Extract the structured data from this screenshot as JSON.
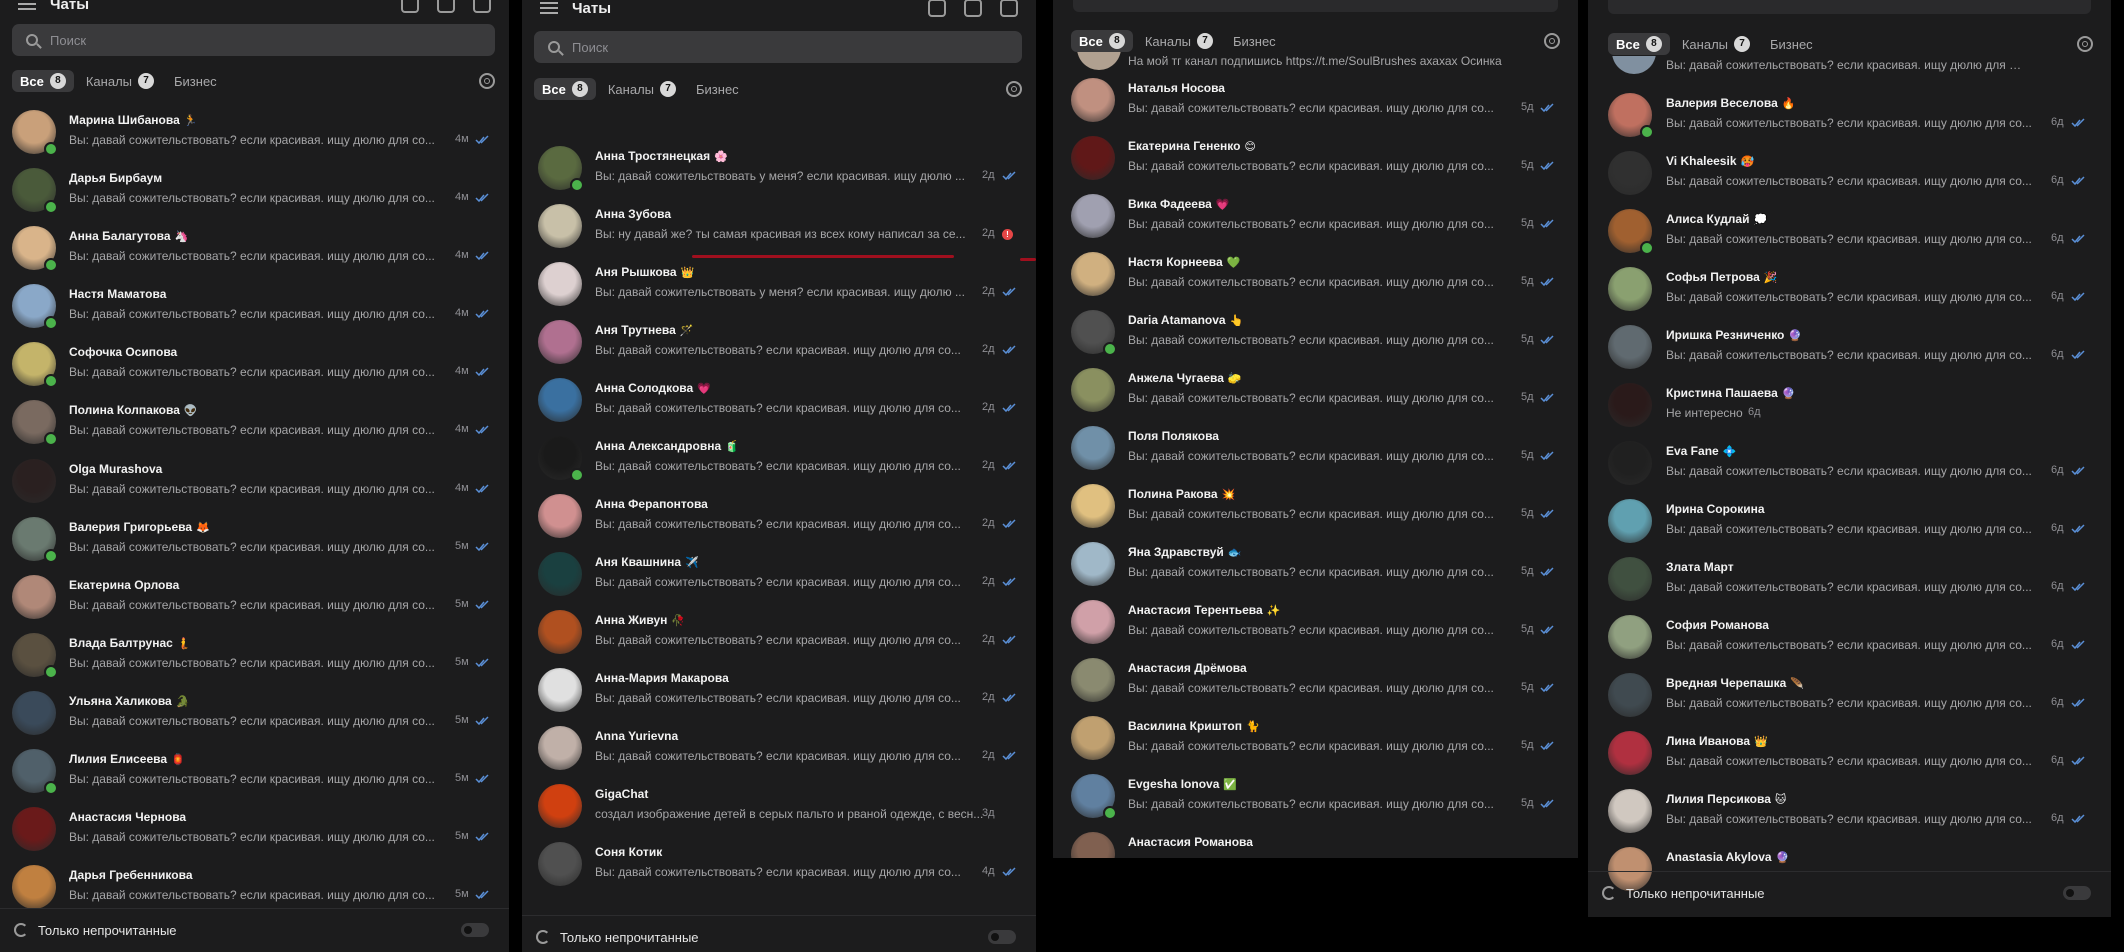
{
  "common": {
    "search_placeholder": "Поиск",
    "filter_all": "Все",
    "filter_all_count": "8",
    "filter_channels": "Каналы",
    "filter_channels_count": "7",
    "filter_business": "Бизнес",
    "footer_label": "Только непрочитанные",
    "title": "Чаты"
  },
  "colors": {
    "online": "#4bb34b",
    "checks": "#5a8fd6",
    "accent_red": "#a00f1e",
    "panel": "#1c1c1d"
  },
  "panels": [
    {
      "time_default": "4м",
      "chats": [
        {
          "name": "Марина Шибанова",
          "emoji": "🏃",
          "msg": "Вы: давай сожительствовать? если красивая. ищу дюлю для со...",
          "time": "4м",
          "online": true,
          "color": "#c9a07a"
        },
        {
          "name": "Дарья Бирбаум",
          "emoji": "",
          "msg": "Вы: давай сожительствовать? если красивая. ищу дюлю для со...",
          "time": "4м",
          "online": true,
          "color": "#4a5a3a"
        },
        {
          "name": "Анна Балагутова",
          "emoji": "🦄",
          "msg": "Вы: давай сожительствовать? если красивая. ищу дюлю для со...",
          "time": "4м",
          "online": true,
          "color": "#d9b48a"
        },
        {
          "name": "Настя Маматова",
          "emoji": "",
          "msg": "Вы: давай сожительствовать? если красивая. ищу дюлю для со...",
          "time": "4м",
          "online": true,
          "color": "#8aa8c8"
        },
        {
          "name": "Софочка Осипова",
          "emoji": "",
          "msg": "Вы: давай сожительствовать? если красивая. ищу дюлю для со...",
          "time": "4м",
          "online": true,
          "color": "#c4b46a"
        },
        {
          "name": "Полина Колпакова",
          "emoji": "👽",
          "msg": "Вы: давай сожительствовать? если красивая. ищу дюлю для со...",
          "time": "4м",
          "online": true,
          "color": "#7a6a60"
        },
        {
          "name": "Olga Murashova",
          "emoji": "",
          "msg": "Вы: давай сожительствовать? если красивая. ищу дюлю для со...",
          "time": "4м",
          "online": false,
          "color": "#2a2020"
        },
        {
          "name": "Валерия Григорьева",
          "emoji": "🦊",
          "msg": "Вы: давай сожительствовать? если красивая. ищу дюлю для со...",
          "time": "5м",
          "online": true,
          "color": "#6a7a70"
        },
        {
          "name": "Екатерина Орлова",
          "emoji": "",
          "msg": "Вы: давай сожительствовать? если красивая. ищу дюлю для со...",
          "time": "5м",
          "online": false,
          "color": "#b08878"
        },
        {
          "name": "Влада Балтрунас",
          "emoji": "🧜",
          "msg": "Вы: давай сожительствовать? если красивая. ищу дюлю для со...",
          "time": "5м",
          "online": true,
          "color": "#5a5040"
        },
        {
          "name": "Ульяна Халикова",
          "emoji": "🐊",
          "msg": "Вы: давай сожительствовать? если красивая. ищу дюлю для со...",
          "time": "5м",
          "online": false,
          "color": "#3a4a5a"
        },
        {
          "name": "Лилия Елисеева",
          "emoji": "🏮",
          "msg": "Вы: давай сожительствовать? если красивая. ищу дюлю для со...",
          "time": "5м",
          "online": true,
          "color": "#50606a"
        },
        {
          "name": "Анастасия Чернова",
          "emoji": "",
          "msg": "Вы: давай сожительствовать? если красивая. ищу дюлю для со...",
          "time": "5м",
          "online": false,
          "color": "#6a1a1a"
        },
        {
          "name": "Дарья Гребенникова",
          "emoji": "",
          "msg": "Вы: давай сожительствовать? если красивая. ищу дюлю для со...",
          "time": "5м",
          "online": false,
          "color": "#c08040"
        }
      ]
    },
    {
      "chats": [
        {
          "name": "Анна Тростянецкая",
          "emoji": "🌸",
          "msg": "Вы: давай сожительствовать у меня? если красивая. ищу дюлю ...",
          "time": "2д",
          "online": true,
          "color": "#5a6a40"
        },
        {
          "name": "Анна Зубова",
          "emoji": "",
          "msg": "Вы: ну давай же? ты самая красивая из всех кому написал за се...",
          "time": "2д",
          "online": false,
          "color": "#c8c0a8",
          "unread": true
        },
        {
          "name": "Аня Рышкова",
          "emoji": "👑",
          "msg": "Вы: давай сожительствовать у меня? если красивая. ищу дюлю ...",
          "time": "2д",
          "online": false,
          "color": "#ddd0d0"
        },
        {
          "name": "Аня Трутнева",
          "emoji": "🪄",
          "msg": "Вы: давай сожительствовать? если красивая. ищу дюлю для со...",
          "time": "2д",
          "online": false,
          "color": "#b07090"
        },
        {
          "name": "Анна Солодкова",
          "emoji": "💗",
          "msg": "Вы: давай сожительствовать? если красивая. ищу дюлю для со...",
          "time": "2д",
          "online": false,
          "color": "#3a70a0"
        },
        {
          "name": "Анна Александровна",
          "emoji": "🧃",
          "msg": "Вы: давай сожительствовать? если красивая. ищу дюлю для со...",
          "time": "2д",
          "online": true,
          "color": "#1a1a1a"
        },
        {
          "name": "Анна Ферапонтова",
          "emoji": "",
          "msg": "Вы: давай сожительствовать? если красивая. ищу дюлю для со...",
          "time": "2д",
          "online": false,
          "color": "#d09090"
        },
        {
          "name": "Аня Квашнина",
          "emoji": "✈️",
          "msg": "Вы: давай сожительствовать? если красивая. ищу дюлю для со...",
          "time": "2д",
          "online": false,
          "color": "#1a4040"
        },
        {
          "name": "Анна Живун",
          "emoji": "🥀",
          "msg": "Вы: давай сожительствовать? если красивая. ищу дюлю для со...",
          "time": "2д",
          "online": false,
          "color": "#b05020"
        },
        {
          "name": "Анна-Мария Макарова",
          "emoji": "",
          "msg": "Вы: давай сожительствовать? если красивая. ищу дюлю для со...",
          "time": "2д",
          "online": false,
          "color": "#e0e0e0"
        },
        {
          "name": "Anna Yurievna",
          "emoji": "",
          "msg": "Вы: давай сожительствовать? если красивая. ищу дюлю для со...",
          "time": "2д",
          "online": false,
          "color": "#c0b0a8"
        },
        {
          "name": "GigaChat",
          "emoji": "",
          "msg": "создал изображение детей в серых пальто и рваной одежде, с весн...",
          "time": "3д",
          "online": false,
          "color": "#d04010",
          "nocheck": true
        },
        {
          "name": "Соня Котик",
          "emoji": "",
          "msg": "Вы: давай сожительствовать? если красивая. ищу дюлю для со...",
          "time": "4д",
          "online": false,
          "color": "#505050"
        }
      ]
    },
    {
      "top_fragment": "На мой тг канал подпишись https://t.me/SoulBrushes ахахах Осинка",
      "chats": [
        {
          "name": "Наталья Носова",
          "emoji": "",
          "msg": "Вы: давай сожительствовать? если красивая. ищу дюлю для со...",
          "time": "5д",
          "online": false,
          "color": "#c09080"
        },
        {
          "name": "Екатерина Гененко",
          "emoji": "😊",
          "msg": "Вы: давай сожительствовать? если красивая. ищу дюлю для со...",
          "time": "5д",
          "online": false,
          "color": "#601818"
        },
        {
          "name": "Вика Фадеева",
          "emoji": "💗",
          "msg": "Вы: давай сожительствовать? если красивая. ищу дюлю для со...",
          "time": "5д",
          "online": false,
          "color": "#a0a0b0"
        },
        {
          "name": "Настя Корнеева",
          "emoji": "💚",
          "msg": "Вы: давай сожительствовать? если красивая. ищу дюлю для со...",
          "time": "5д",
          "online": false,
          "color": "#d0b080"
        },
        {
          "name": "Daria Atamanova",
          "emoji": "👆",
          "msg": "Вы: давай сожительствовать? если красивая. ищу дюлю для со...",
          "time": "5д",
          "online": true,
          "color": "#505050"
        },
        {
          "name": "Анжела Чугаева",
          "emoji": "🧽",
          "msg": "Вы: давай сожительствовать? если красивая. ищу дюлю для со...",
          "time": "5д",
          "online": false,
          "color": "#8a9060"
        },
        {
          "name": "Поля Полякова",
          "emoji": "",
          "msg": "Вы: давай сожительствовать? если красивая. ищу дюлю для со...",
          "time": "5д",
          "online": false,
          "color": "#7090a8"
        },
        {
          "name": "Полина Ракова",
          "emoji": "💥",
          "msg": "Вы: давай сожительствовать? если красивая. ищу дюлю для со...",
          "time": "5д",
          "online": false,
          "color": "#e0c080"
        },
        {
          "name": "Яна Здравствуй",
          "emoji": "🐟",
          "msg": "Вы: давай сожительствовать? если красивая. ищу дюлю для со...",
          "time": "5д",
          "online": false,
          "color": "#a0b8c8"
        },
        {
          "name": "Анастасия Терентьева",
          "emoji": "✨",
          "msg": "Вы: давай сожительствовать? если красивая. ищу дюлю для со...",
          "time": "5д",
          "online": false,
          "color": "#d0a0a8"
        },
        {
          "name": "Анастасия Дрёмова",
          "emoji": "",
          "msg": "Вы: давай сожительствовать? если красивая. ищу дюлю для со...",
          "time": "5д",
          "online": false,
          "color": "#8a8a70"
        },
        {
          "name": "Василина Криштоп",
          "emoji": "🐈",
          "msg": "Вы: давай сожительствовать? если красивая. ищу дюлю для со...",
          "time": "5д",
          "online": false,
          "color": "#c0a070"
        },
        {
          "name": "Evgesha Ionova",
          "emoji": "✅",
          "msg": "Вы: давай сожительствовать? если красивая. ищу дюлю для со...",
          "time": "5д",
          "online": true,
          "color": "#6080a0"
        },
        {
          "name": "Анастасия Романова",
          "emoji": "",
          "msg": "",
          "time": "",
          "online": false,
          "color": "#806050"
        }
      ]
    },
    {
      "chats": [
        {
          "name": "Валерия Веселова",
          "emoji": "🔥",
          "msg": "Вы: давай сожительствовать? если красивая. ищу дюлю для со...",
          "time": "6д",
          "online": true,
          "color": "#c07060"
        },
        {
          "name": "Vi Khaleesik",
          "emoji": "🥵",
          "msg": "Вы: давай сожительствовать? если красивая. ищу дюлю для со...",
          "time": "6д",
          "online": false,
          "color": "#303030"
        },
        {
          "name": "Алиса Кудлай",
          "emoji": "💭",
          "msg": "Вы: давай сожительствовать? если красивая. ищу дюлю для со...",
          "time": "6д",
          "online": true,
          "color": "#a06030"
        },
        {
          "name": "Софья Петрова",
          "emoji": "🎉",
          "msg": "Вы: давай сожительствовать? если красивая. ищу дюлю для со...",
          "time": "6д",
          "online": false,
          "color": "#8aa070"
        },
        {
          "name": "Иришка Резниченко",
          "emoji": "🔮",
          "msg": "Вы: давай сожительствовать? если красивая. ищу дюлю для со...",
          "time": "6д",
          "online": false,
          "color": "#606a70"
        },
        {
          "name": "Кристина Пашаева",
          "emoji": "🔮",
          "msg": "Не интересно",
          "time": "6д",
          "online": false,
          "color": "#2a1a1a",
          "nocheck": true
        },
        {
          "name": "Eva Fane",
          "emoji": "💠",
          "msg": "Вы: давай сожительствовать? если красивая. ищу дюлю для со...",
          "time": "6д",
          "online": false,
          "color": "#202020"
        },
        {
          "name": "Ирина Сорокина",
          "emoji": "",
          "msg": "Вы: давай сожительствовать? если красивая. ищу дюлю для со...",
          "time": "6д",
          "online": false,
          "color": "#60a0b0"
        },
        {
          "name": "Злата Март",
          "emoji": "",
          "msg": "Вы: давай сожительствовать? если красивая. ищу дюлю для со...",
          "time": "6д",
          "online": false,
          "color": "#405040"
        },
        {
          "name": "София Романова",
          "emoji": "",
          "msg": "Вы: давай сожительствовать? если красивая. ищу дюлю для со...",
          "time": "6д",
          "online": false,
          "color": "#90a080"
        },
        {
          "name": "Вредная Черепашка",
          "emoji": "🪶",
          "msg": "Вы: давай сожительствовать? если красивая. ищу дюлю для со...",
          "time": "6д",
          "online": false,
          "color": "#404a50"
        },
        {
          "name": "Лина Иванова",
          "emoji": "👑",
          "msg": "Вы: давай сожительствовать? если красивая. ищу дюлю для со...",
          "time": "6д",
          "online": false,
          "color": "#b03040"
        },
        {
          "name": "Лилия Персикова",
          "emoji": "🐱",
          "msg": "Вы: давай сожительствовать? если красивая. ищу дюлю для со...",
          "time": "6д",
          "online": false,
          "color": "#d0c8c0"
        },
        {
          "name": "Anastasia Akylova",
          "emoji": "🔮",
          "msg": "",
          "time": "",
          "online": false,
          "color": "#c09070"
        }
      ]
    }
  ]
}
